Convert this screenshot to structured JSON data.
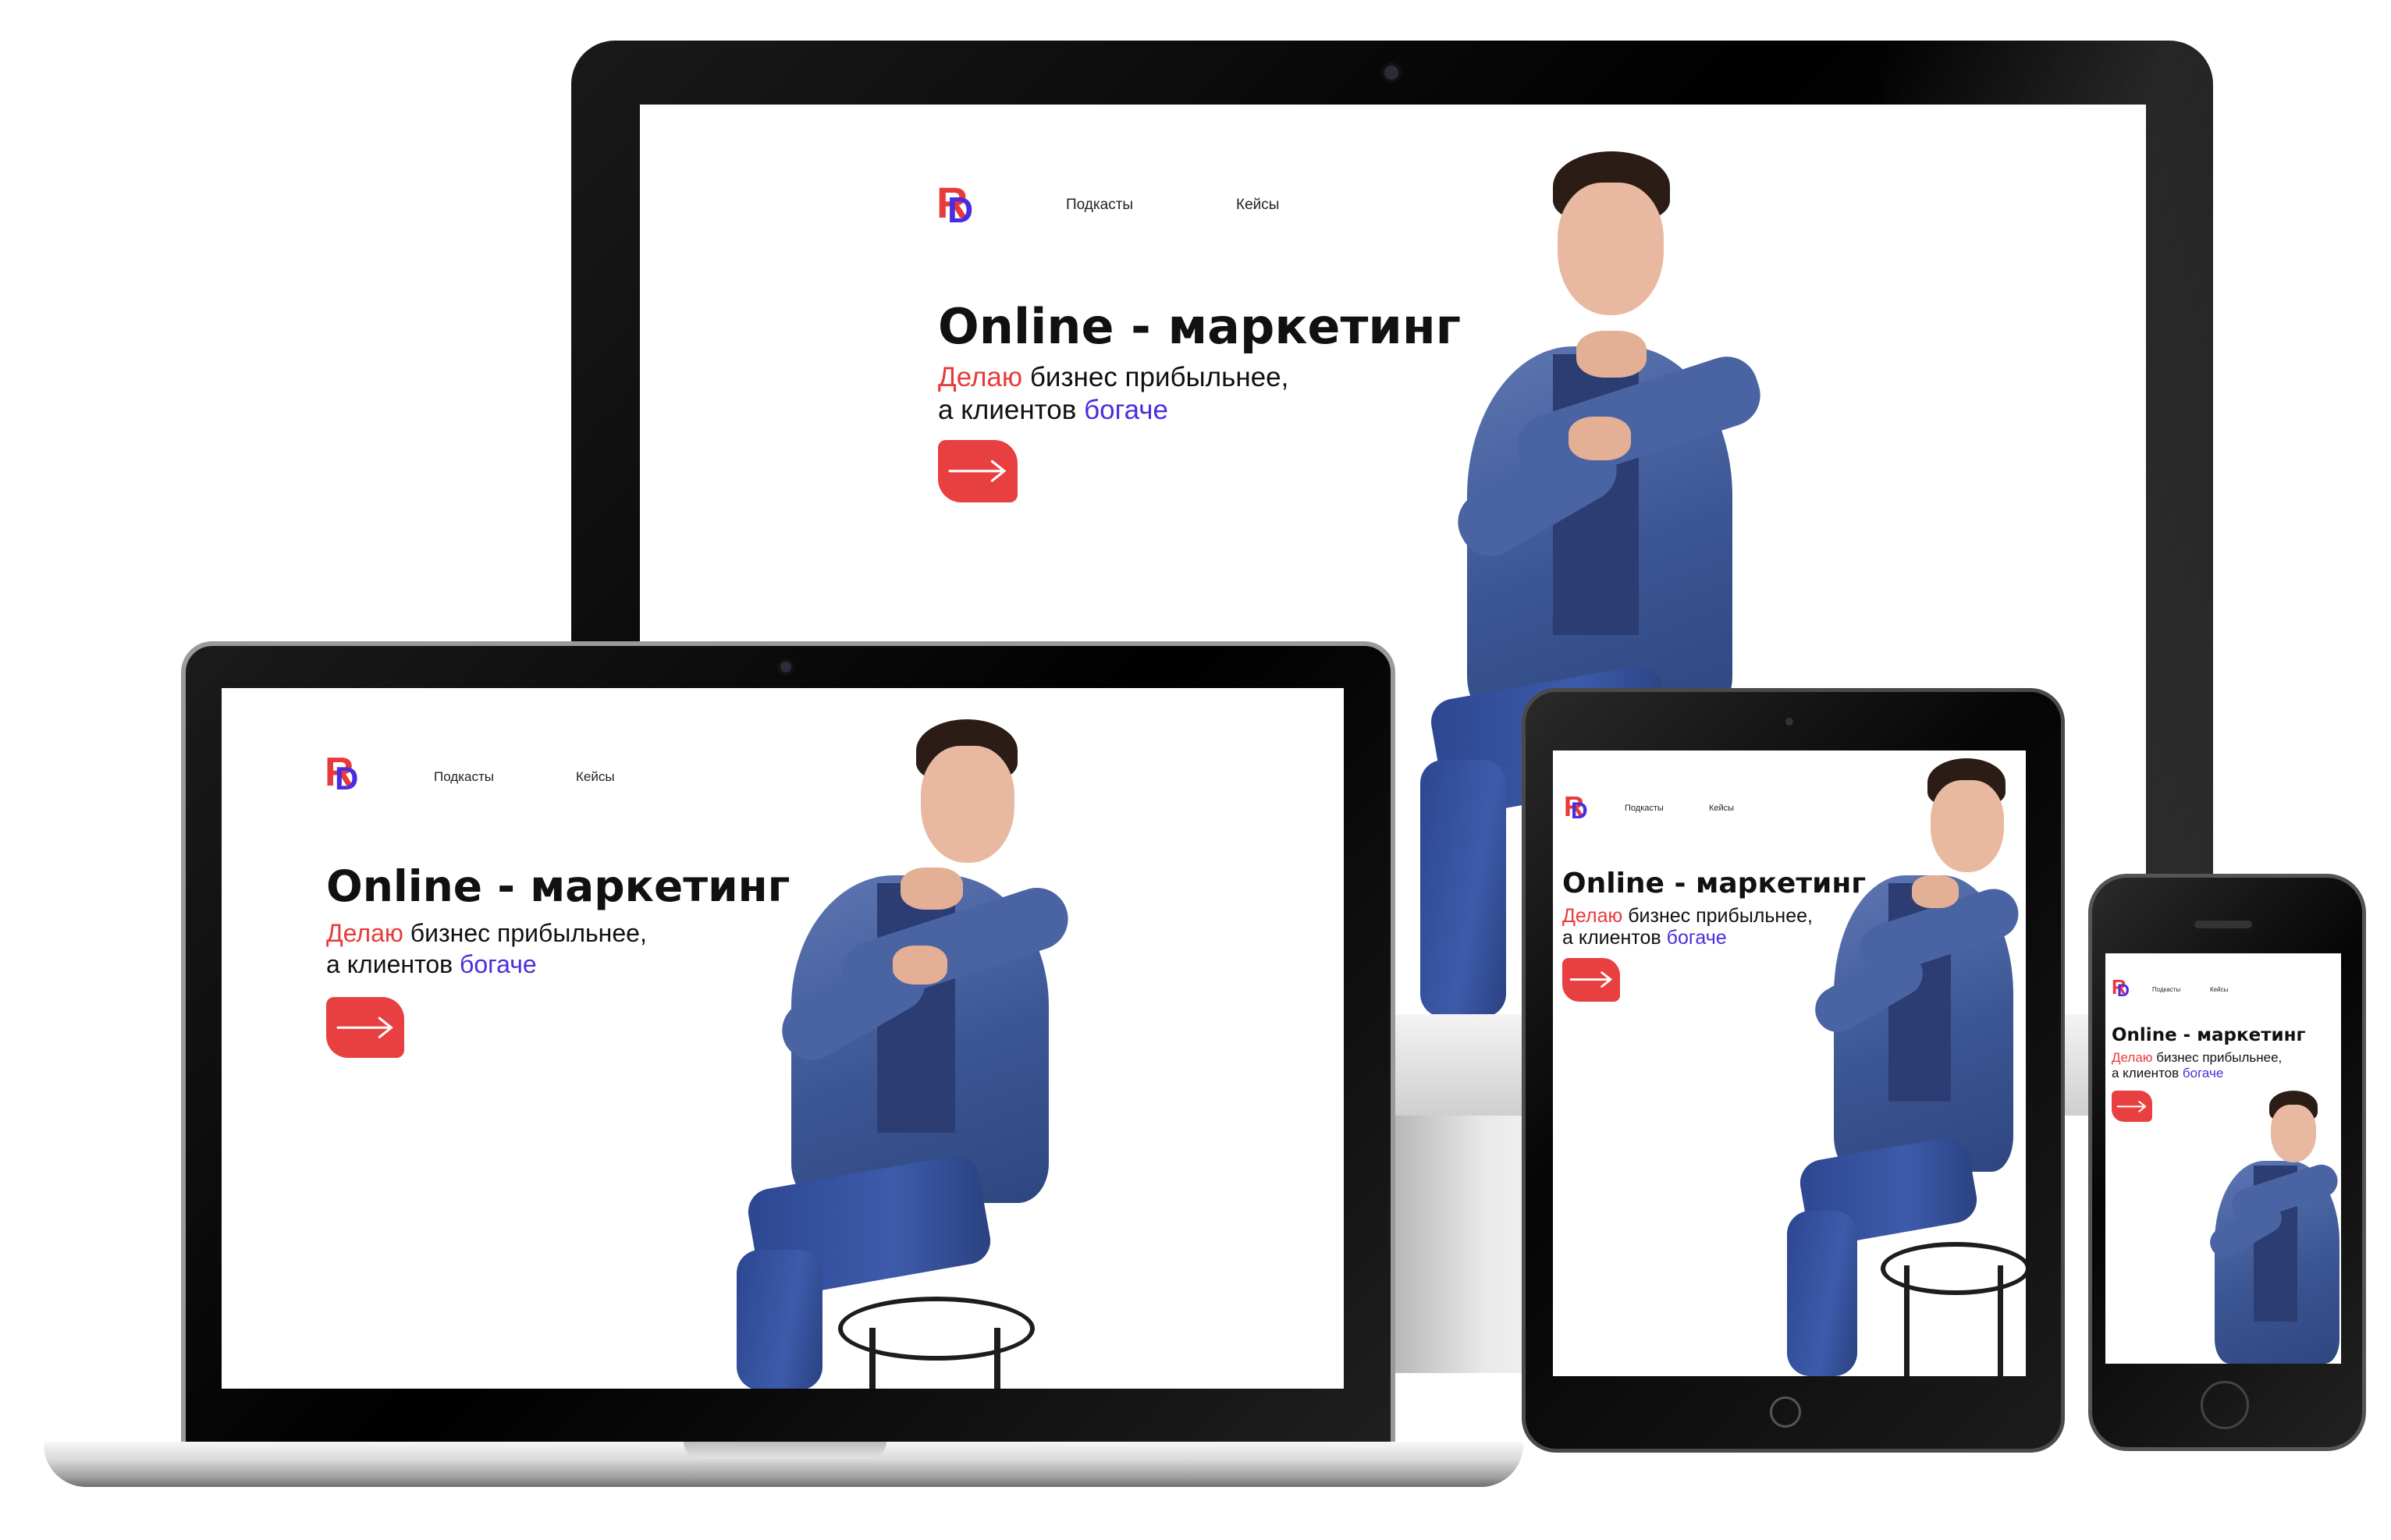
{
  "site": {
    "logo": {
      "letter1": "R",
      "letter2": "D"
    },
    "nav": {
      "podcasts": "Подкасты",
      "cases": "Кейсы"
    },
    "hero": {
      "title": "Online - маркетинг",
      "line1_highlight": "Делаю",
      "line1_rest": " бизнес прибыльнее,",
      "line2_start": "а клиентов ",
      "line2_highlight": "богаче"
    },
    "cta_icon": "arrow-right-icon"
  },
  "colors": {
    "accent_red": "#e83a3a",
    "accent_blue": "#4a2de0",
    "button_red": "#e84040",
    "jacket_blue": "#3c5694"
  },
  "devices": [
    "desktop-monitor",
    "laptop",
    "tablet",
    "phone"
  ]
}
